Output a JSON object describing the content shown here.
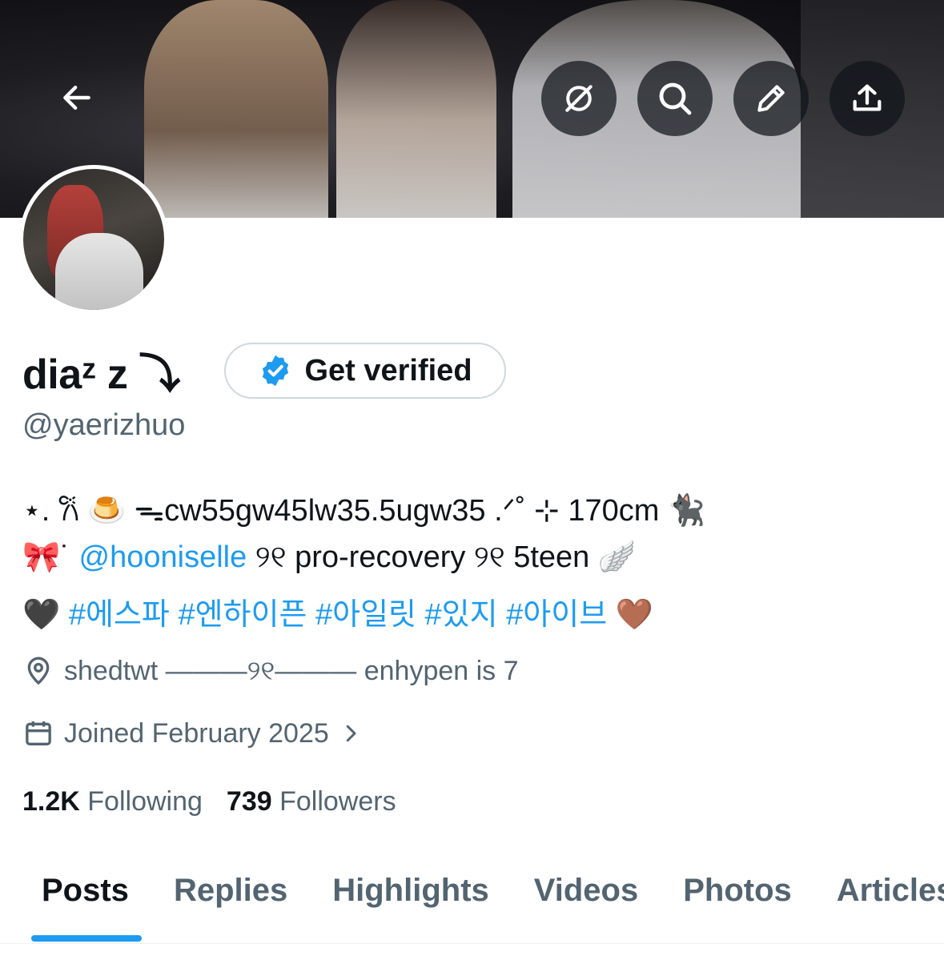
{
  "profile": {
    "display_name": "diaᶻ z ⤵",
    "handle": "@yaerizhuo",
    "verify_label": "Get verified"
  },
  "bio": {
    "line1": "⋆. 𐙚 🍮 ᯓcw55gw45lw35.5ugw35 .ᐟ˚ ⊹ 170cm 🐈‍⬛",
    "line2_prefix": "🎀˙",
    "line2_mention": "@hooniselle",
    "line2_suffix": " ୨୧ pro-recovery ୨୧ 5teen 🪽",
    "line3_prefix": "🖤 ",
    "line3_tags": "#에스파 #엔하이픈 #아일릿 #있지 #아이브",
    "line3_suffix": " 🤎"
  },
  "meta": {
    "location": "shedtwt ———୨୧——— enhypen is 7",
    "joined": "Joined February 2025"
  },
  "stats": {
    "following_count": "1.2K",
    "following_label": "Following",
    "followers_count": "739",
    "followers_label": "Followers"
  },
  "tabs": [
    "Posts",
    "Replies",
    "Highlights",
    "Videos",
    "Photos",
    "Articles"
  ],
  "icons": [
    "back-arrow-icon",
    "grok-icon",
    "search-icon",
    "pencil-icon",
    "share-icon",
    "verified-badge-icon",
    "location-icon",
    "calendar-icon",
    "chevron-right-icon"
  ],
  "colors": {
    "accent": "#1d9bf0",
    "secondary_text": "#536471",
    "primary_text": "#0f1419"
  }
}
